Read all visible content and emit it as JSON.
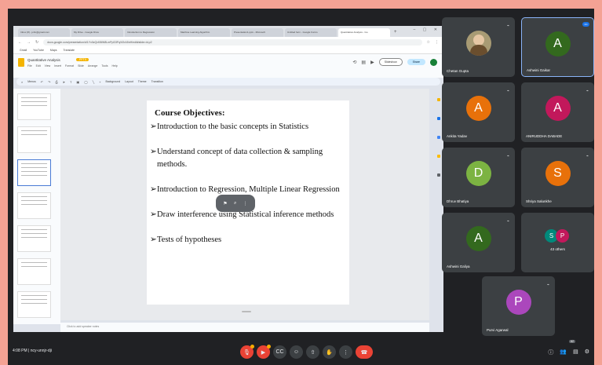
{
  "browser": {
    "tabs": [
      "Inbox (8) - john@gmail.com",
      "My Drive - Google Drive",
      "Introduction to Regression",
      "Machine Learning Algorithm",
      "Presentation1.pptx - Microsoft",
      "Untitled form - Google Forms",
      "Quantitative Analysis - Go"
    ],
    "url": "docs.google.com/presentation/d/1Yx0zQvK8iW8LmPpD3FqVt2rA5nH/edit#slide=id.p2",
    "bookmarks": [
      "Gmail",
      "YouTube",
      "Maps",
      "Translate"
    ]
  },
  "docs": {
    "title": "Quantitative Analysis",
    "badge": ".PPTX",
    "menu": [
      "File",
      "Edit",
      "View",
      "Insert",
      "Format",
      "Slide",
      "Arrange",
      "Tools",
      "Help"
    ],
    "slideshow_label": "Slideshow",
    "share_label": "Share",
    "toolbar": [
      "Menus",
      "Background",
      "Layout",
      "Theme",
      "Transition"
    ],
    "notes_placeholder": "Click to add speaker notes"
  },
  "slide": {
    "title": "Course Objectives:",
    "bullets": [
      "Introduction to the basic concepts in Statistics",
      "Understand concept of data collection & sampling methods.",
      "Introduction to Regression, Multiple Linear Regression",
      "Draw interference using Statistical inference methods",
      "Tests of hypotheses"
    ]
  },
  "participants": [
    {
      "name": "Chetan Gupta",
      "initial": "",
      "color": "",
      "photo": true
    },
    {
      "name": "Ashwini Gaikar",
      "initial": "A",
      "color": "#33691e",
      "speaking": true
    },
    {
      "name": "Ankita Yadav",
      "initial": "A",
      "color": "#e8710a"
    },
    {
      "name": "ANIRUDDHA DABADE",
      "initial": "A",
      "color": "#c2185b"
    },
    {
      "name": "Dhruv Bhatiya",
      "initial": "D",
      "color": "#7cb342"
    },
    {
      "name": "Shriya Salunkhe",
      "initial": "S",
      "color": "#e8710a"
    },
    {
      "name": "Ashwini Galiya",
      "initial": "A",
      "color": "#33691e"
    },
    {
      "name": "43 others",
      "others": [
        "S",
        "P"
      ]
    },
    {
      "name": "Purvi Agarwal",
      "initial": "P",
      "color": "#ab47bc"
    }
  ],
  "bottom": {
    "time": "4:08 PM",
    "meeting_code": "ncy-unnjr-dji",
    "people_count": "62"
  }
}
